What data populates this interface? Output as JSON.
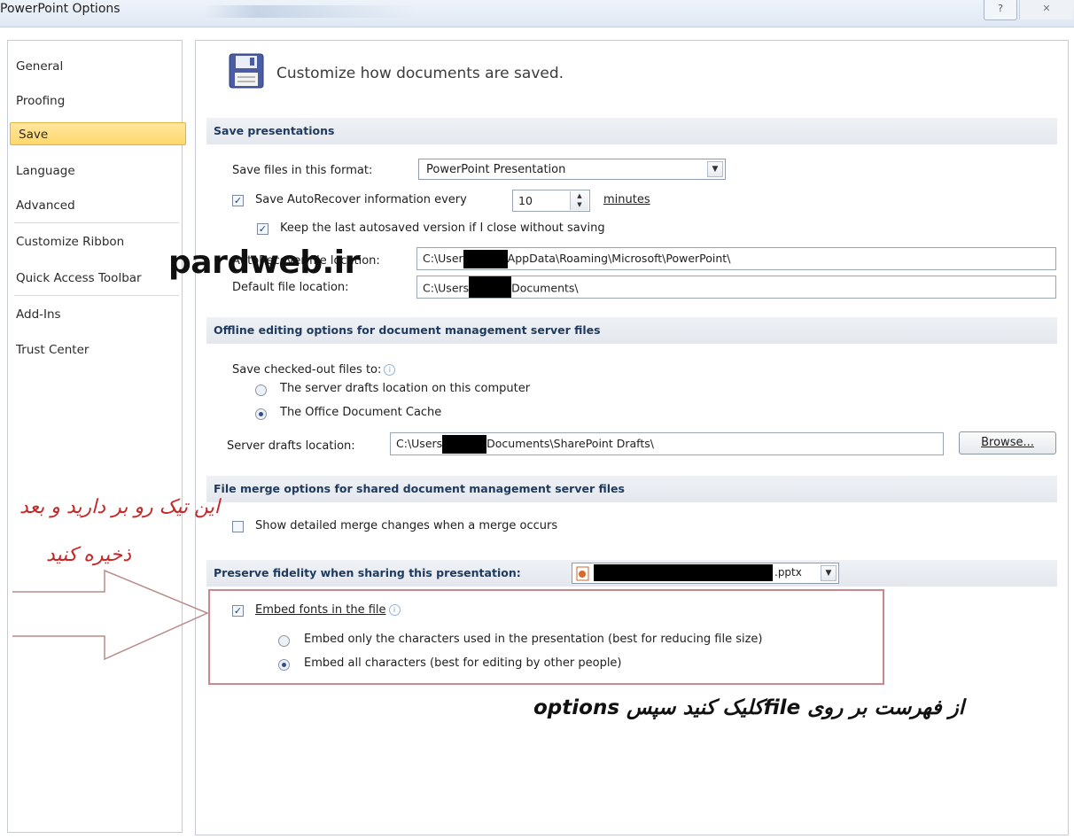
{
  "window": {
    "title": "PowerPoint Options",
    "help_label": "?",
    "close_label": "✕"
  },
  "nav": {
    "items": [
      {
        "label": "General"
      },
      {
        "label": "Proofing"
      },
      {
        "label": "Save",
        "selected": true
      },
      {
        "label": "Language"
      },
      {
        "label": "Advanced"
      },
      {
        "label": "Customize Ribbon"
      },
      {
        "label": "Quick Access Toolbar"
      },
      {
        "label": "Add-Ins"
      },
      {
        "label": "Trust Center"
      }
    ]
  },
  "main": {
    "heading": "Customize how documents are saved.",
    "save_presentations": {
      "header": "Save presentations",
      "format_label": "Save files in this format:",
      "format_value": "PowerPoint Presentation",
      "autorecover_label": "Save AutoRecover information every",
      "autorecover_checked": true,
      "autorecover_minutes": "10",
      "minutes_label": "minutes",
      "keep_last_label": "Keep the last autosaved version if I close without saving",
      "keep_last_checked": true,
      "autorecover_location_label": "AutoRecover file location:",
      "autorecover_location_pre": "C:\\User",
      "autorecover_location_post": "AppData\\Roaming\\Microsoft\\PowerPoint\\",
      "default_location_label": "Default file location:",
      "default_location_pre": "C:\\Users",
      "default_location_post": "Documents\\"
    },
    "offline": {
      "header": "Offline editing options for document management server files",
      "save_checked_out_label": "Save checked-out files to:",
      "option_server": "The server drafts location on this computer",
      "option_cache": "The Office Document Cache",
      "selected": "cache",
      "server_drafts_label": "Server drafts location:",
      "server_drafts_pre": "C:\\Users",
      "server_drafts_post": "Documents\\SharePoint Drafts\\",
      "browse_label": "Browse..."
    },
    "file_merge": {
      "header": "File merge options for shared document management server files",
      "show_detailed_label": "Show detailed merge changes when a merge occurs",
      "show_detailed_checked": false
    },
    "fidelity": {
      "header": "Preserve fidelity when sharing this presentation:",
      "file_suffix": ".pptx",
      "embed_fonts_label": "Embed fonts in the file",
      "embed_fonts_checked": true,
      "embed_only_label": "Embed only the characters used in the presentation (best for reducing file size)",
      "embed_all_label": "Embed all characters (best for editing by other people)",
      "selected": "all"
    }
  },
  "annotations": {
    "watermark": "pardweb.ir",
    "red_note_line1": "این تیک رو بر دارید و بعد",
    "red_note_line2": "ذخیره کنید",
    "black_note": "از فهرست بر روی fileکلیک کنید سپس options"
  },
  "colors": {
    "selected_nav": "#ffd76b",
    "section_header": "#e4e8ee",
    "annotation_red": "#c62828",
    "highlight_box": "#c9888c"
  }
}
